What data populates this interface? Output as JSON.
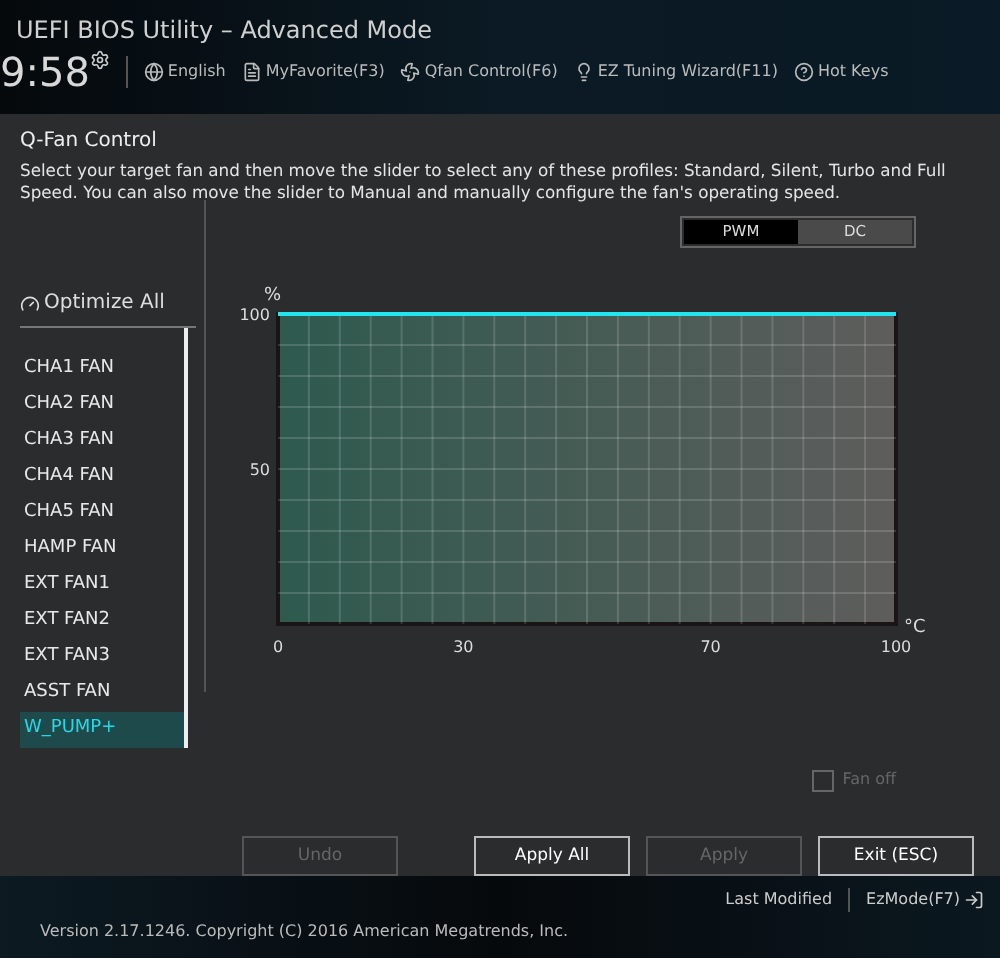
{
  "window": {
    "title": "UEFI BIOS Utility – Advanced Mode"
  },
  "header": {
    "time": "9:58",
    "items": [
      {
        "kind": "globe",
        "label": "English"
      },
      {
        "kind": "favorite",
        "label": "MyFavorite(F3)"
      },
      {
        "kind": "fan",
        "label": "Qfan Control(F6)"
      },
      {
        "kind": "bulb",
        "label": "EZ Tuning Wizard(F11)"
      },
      {
        "kind": "help",
        "label": "Hot Keys"
      }
    ]
  },
  "dialog": {
    "title": "Q-Fan Control",
    "description": "Select your target fan and then move the slider to select any of these profiles: Standard, Silent, Turbo and Full Speed. You can also move the slider to Manual and manually configure the fan's operating speed.",
    "optimize_all": "Optimize All",
    "fans": [
      {
        "label": "CHA1 FAN",
        "selected": false
      },
      {
        "label": "CHA2 FAN",
        "selected": false
      },
      {
        "label": "CHA3 FAN",
        "selected": false
      },
      {
        "label": "CHA4 FAN",
        "selected": false
      },
      {
        "label": "CHA5 FAN",
        "selected": false
      },
      {
        "label": "HAMP FAN",
        "selected": false
      },
      {
        "label": "EXT FAN1",
        "selected": false
      },
      {
        "label": "EXT FAN2",
        "selected": false
      },
      {
        "label": "EXT FAN3",
        "selected": false
      },
      {
        "label": "ASST FAN",
        "selected": false
      },
      {
        "label": "W_PUMP+",
        "selected": true
      }
    ],
    "modes": [
      {
        "label": "PWM",
        "selected": true
      },
      {
        "label": "DC",
        "selected": false
      }
    ],
    "chart_data": {
      "type": "line",
      "xlabel": "°C",
      "ylabel": "%",
      "x": [
        0,
        100
      ],
      "series": [
        {
          "color": "#22e5f0",
          "values": [
            100,
            100
          ]
        }
      ],
      "xlim": [
        0,
        100
      ],
      "ylim": [
        0,
        100
      ],
      "xticks": [
        0,
        30,
        70,
        100
      ],
      "yticks": [
        50,
        100
      ],
      "grid": true
    },
    "fan_off": {
      "label": "Fan off",
      "checked": false,
      "disabled": true
    },
    "buttons": [
      {
        "label": "Undo",
        "disabled": true
      },
      {
        "label": "Apply All",
        "disabled": false
      },
      {
        "label": "Apply",
        "disabled": true
      },
      {
        "label": "Exit (ESC)",
        "disabled": false
      }
    ]
  },
  "footer": {
    "last_modified": "Last Modified",
    "ez_mode": "EzMode(F7)",
    "version": "Version 2.17.1246. Copyright (C) 2016 American Megatrends, Inc."
  }
}
